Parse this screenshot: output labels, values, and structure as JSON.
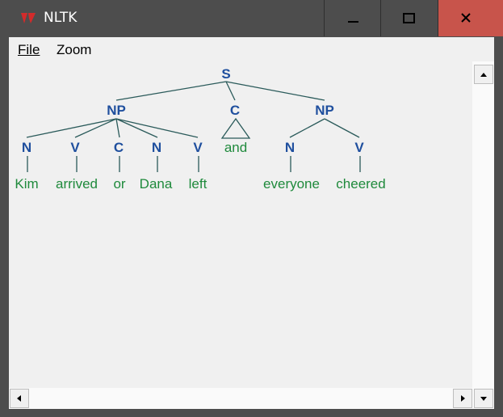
{
  "window": {
    "title": "NLTK",
    "app_icon": "tk-feather-icon"
  },
  "controls": {
    "minimize": "minimize-icon",
    "maximize": "maximize-icon",
    "close": "close-icon"
  },
  "menu": {
    "file": "File",
    "zoom": "Zoom"
  },
  "colors": {
    "node": "#1f4f9e",
    "leaf": "#1f8a3c",
    "edge": "#2a5a5a",
    "close_bg": "#c8544b"
  },
  "tree": {
    "root": "S",
    "np1": "NP",
    "c": "C",
    "np2": "NP",
    "np1_children": [
      "N",
      "V",
      "C",
      "N",
      "V"
    ],
    "np1_leaves": [
      "Kim",
      "arrived",
      "or",
      "Dana",
      "left"
    ],
    "c_leaf": "and",
    "np2_children": [
      "N",
      "V"
    ],
    "np2_leaves": [
      "everyone",
      "cheered"
    ]
  },
  "scrollbars": {
    "up": "up-arrow-icon",
    "down": "down-arrow-icon",
    "left": "left-arrow-icon",
    "right": "right-arrow-icon"
  }
}
